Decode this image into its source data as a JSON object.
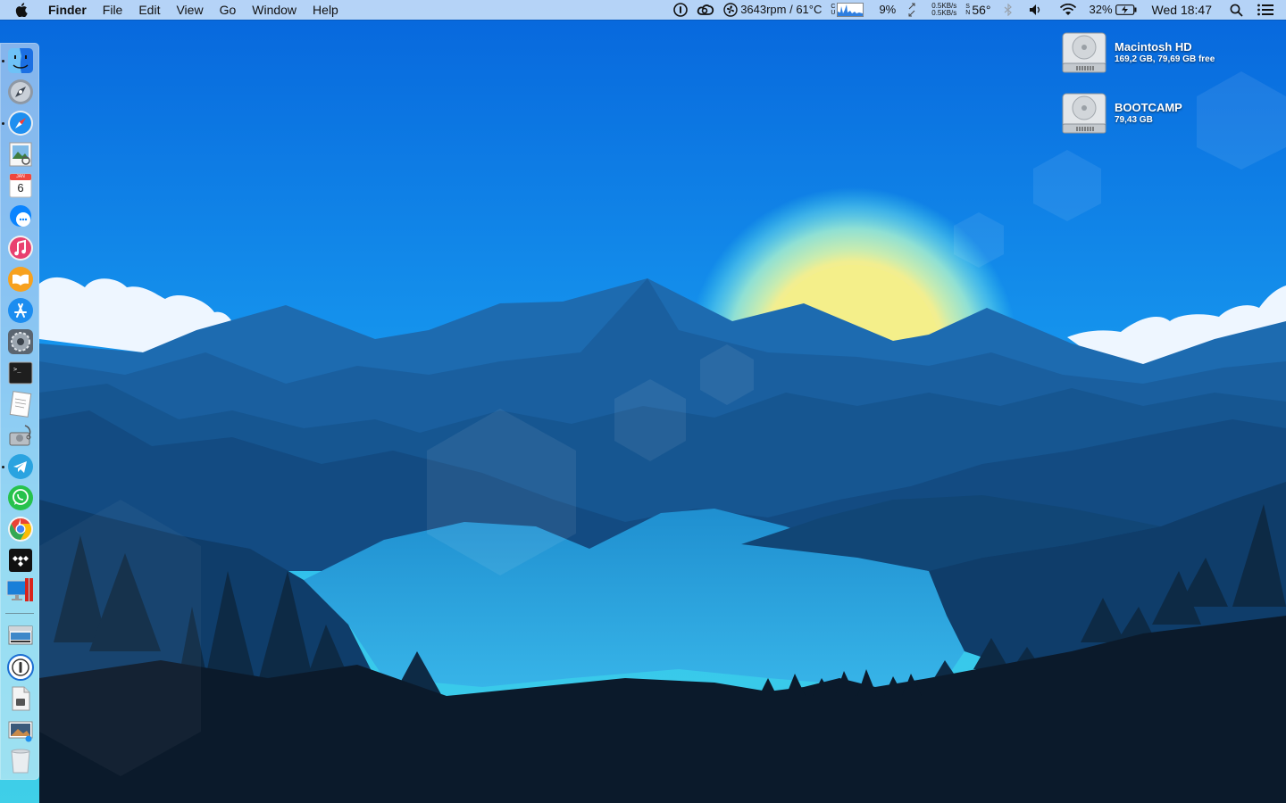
{
  "menubar": {
    "app_name": "Finder",
    "menus": [
      "File",
      "Edit",
      "View",
      "Go",
      "Window",
      "Help"
    ],
    "status": {
      "fan_temp": "3643rpm / 61°C",
      "cpu_label_top": "C",
      "cpu_label_bottom": "U",
      "cpu_percent": "9%",
      "net_up": "0.5KB/s",
      "net_down": "0.5KB/s",
      "sensor_label_top": "S",
      "sensor_label_bottom": "N",
      "sensor_temp": "56°",
      "battery_percent": "32%",
      "clock": "Wed 18:47"
    },
    "status_icons": [
      "1password-icon",
      "creative-cloud-icon",
      "fan-icon",
      "cpu-graph-icon",
      "network-arrows-icon",
      "bluetooth-icon",
      "volume-icon",
      "wifi-icon",
      "battery-charging-icon",
      "spotlight-search-icon",
      "notification-center-icon"
    ]
  },
  "dock": {
    "items": [
      {
        "name": "finder",
        "icon": "finder-icon",
        "running": true
      },
      {
        "name": "launchpad",
        "icon": "launchpad-icon",
        "running": false
      },
      {
        "name": "safari",
        "icon": "safari-icon",
        "running": true
      },
      {
        "name": "preview",
        "icon": "preview-icon",
        "running": false
      },
      {
        "name": "calendar",
        "icon": "calendar-icon",
        "running": false,
        "label": "6",
        "month": "JAN"
      },
      {
        "name": "messenger",
        "icon": "messenger-icon",
        "running": false
      },
      {
        "name": "itunes",
        "icon": "itunes-icon",
        "running": false
      },
      {
        "name": "ibooks",
        "icon": "ibooks-icon",
        "running": false
      },
      {
        "name": "app-store",
        "icon": "app-store-icon",
        "running": false
      },
      {
        "name": "system-preferences",
        "icon": "system-preferences-icon",
        "running": false
      },
      {
        "name": "terminal",
        "icon": "terminal-icon",
        "running": false,
        "label": ">_"
      },
      {
        "name": "textedit",
        "icon": "textedit-icon",
        "running": false
      },
      {
        "name": "disk-utility",
        "icon": "disk-utility-icon",
        "running": false
      },
      {
        "name": "telegram",
        "icon": "telegram-icon",
        "running": true
      },
      {
        "name": "whatsapp",
        "icon": "whatsapp-icon",
        "running": false
      },
      {
        "name": "chrome",
        "icon": "chrome-icon",
        "running": false
      },
      {
        "name": "tidal",
        "icon": "tidal-icon",
        "running": false
      },
      {
        "name": "parallels",
        "icon": "parallels-icon",
        "running": false
      },
      {
        "name": "finder-window-stack",
        "icon": "window-stack-icon",
        "running": false
      },
      {
        "name": "1password",
        "icon": "1password-icon",
        "running": false
      },
      {
        "name": "documents",
        "icon": "documents-icon",
        "running": false
      },
      {
        "name": "screenshots",
        "icon": "screenshots-icon",
        "running": false
      },
      {
        "name": "trash",
        "icon": "trash-icon",
        "running": false
      }
    ]
  },
  "desktop": {
    "drives": [
      {
        "name": "Macintosh HD",
        "info": "169,2 GB, 79,69 GB free",
        "icon": "hard-drive-icon"
      },
      {
        "name": "BOOTCAMP",
        "info": "79,43 GB",
        "icon": "hard-drive-icon"
      }
    ]
  },
  "colors": {
    "sky_top": "#0a6fe0",
    "sky_mid": "#1fa5f0",
    "sun": "#f3ee8c",
    "mountain_far": "#1c5d9a",
    "mountain_mid": "#12477a",
    "lake": "#2ea7df",
    "forest": "#0c1a2a"
  }
}
